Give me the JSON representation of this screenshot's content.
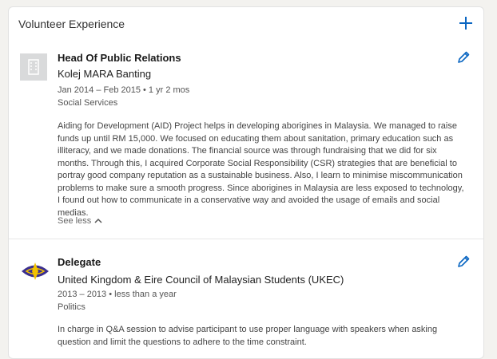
{
  "section": {
    "title": "Volunteer Experience",
    "add_icon": "plus-icon"
  },
  "entries": [
    {
      "role": "Head Of Public Relations",
      "organization": "Kolej MARA Banting",
      "dates": "Jan 2014 – Feb 2015  •  1 yr 2 mos",
      "cause": "Social Services",
      "description": "Aiding for Development (AID) Project helps in developing aborigines in Malaysia. We managed to raise funds up until RM 15,000. We focused on educating them about sanitation, primary education such as illiteracy, and we made donations. The financial source was through fundraising that we did for six months. Through this, I acquired Corporate Social Responsibility (CSR) strategies that are beneficial to portray good company reputation as a sustainable business. Also, I learn to minimise miscommunication problems to make sure a smooth progress. Since aborigines in Malaysia are less exposed to technology, I found out how to communicate in a conservative way and avoided the usage of emails and social medias.",
      "toggle_label": "See less",
      "logo_icon": "building-icon",
      "edit_icon": "pencil-icon"
    },
    {
      "role": "Delegate",
      "organization": "United Kingdom & Eire Council of Malaysian Students (UKEC)",
      "dates": "2013 – 2013  •  less than a year",
      "cause": "Politics",
      "description": "In charge in Q&A session to advise participant to use proper language with speakers when asking question and limit the questions to adhere to the time constraint.",
      "logo_icon": "ukec-logo-icon",
      "edit_icon": "pencil-icon"
    }
  ],
  "colors": {
    "accent": "#0a66c2",
    "logo_purple": "#3b2f8f",
    "logo_yellow": "#f2c200"
  }
}
